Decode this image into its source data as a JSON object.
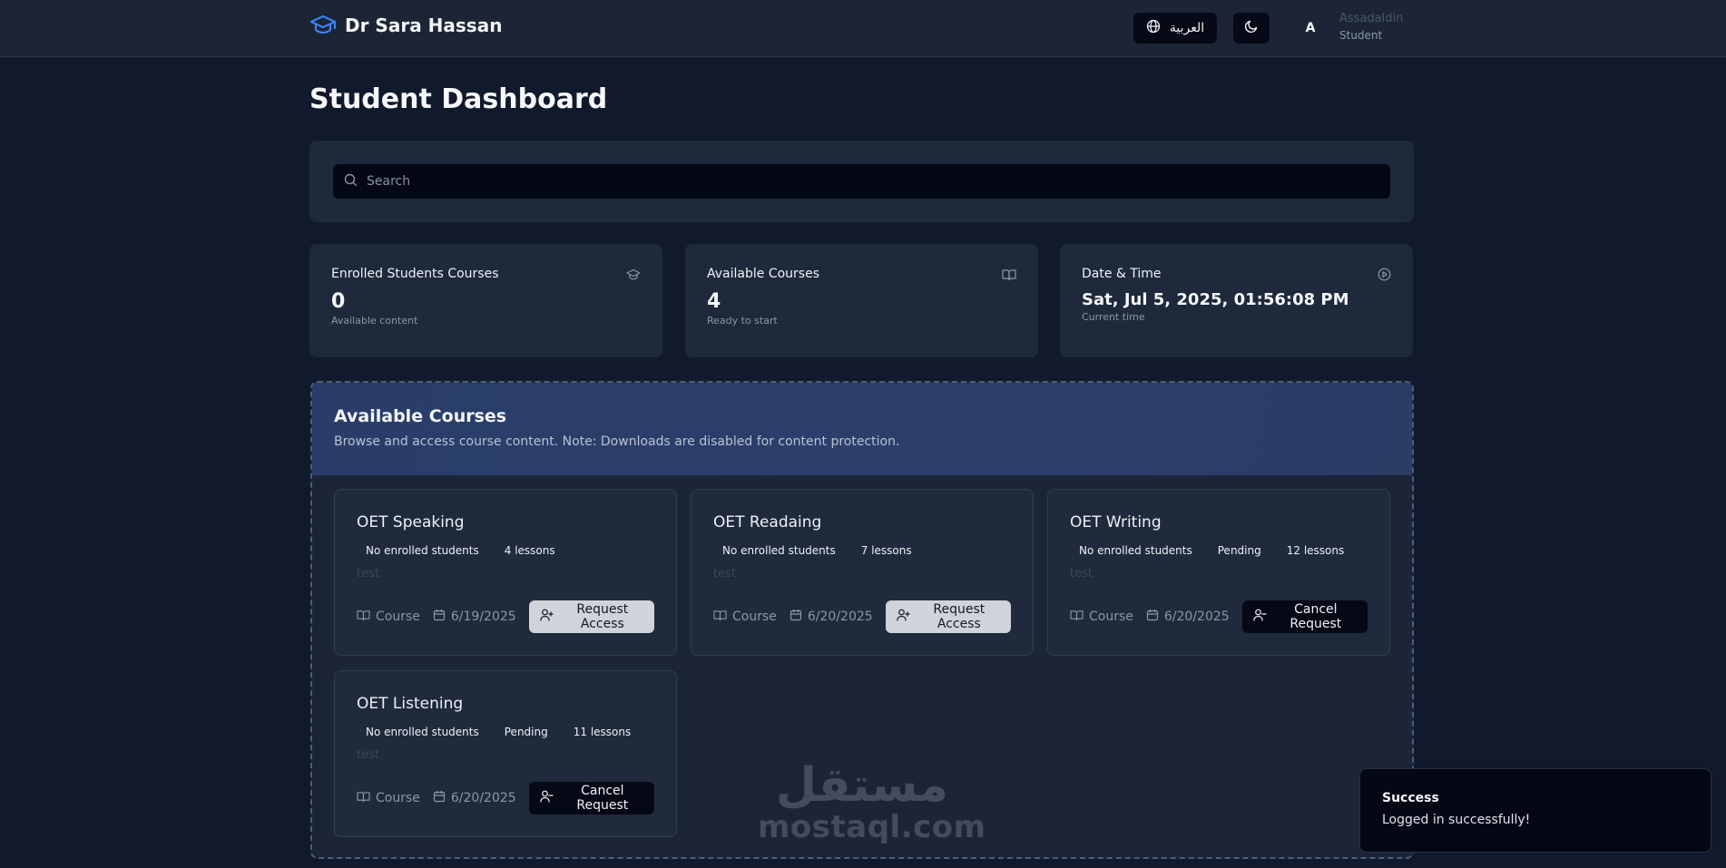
{
  "header": {
    "brand_name": "Dr Sara Hassan",
    "language_label": "العربية",
    "avatar_initial": "A",
    "user_name": "Assadaldin",
    "user_role": "Student"
  },
  "page": {
    "title": "Student Dashboard"
  },
  "search": {
    "placeholder": "Search",
    "value": ""
  },
  "stats": [
    {
      "title": "Enrolled Students Courses",
      "value": "0",
      "sub": "Available content",
      "icon": "graduation-cap-icon"
    },
    {
      "title": "Available Courses",
      "value": "4",
      "sub": "Ready to start",
      "icon": "book-open-icon"
    },
    {
      "title": "Date & Time",
      "value": "Sat, Jul 5, 2025, 01:56:08 PM",
      "sub": "Current time",
      "icon": "play-circle-icon"
    }
  ],
  "courses_section": {
    "title": "Available Courses",
    "description": "Browse and access course content. Note: Downloads are disabled for content protection."
  },
  "courses": [
    {
      "name": "OET Speaking",
      "badges": [
        "No enrolled students",
        "4 lessons"
      ],
      "description": "test",
      "type": "Course",
      "date": "6/19/2025",
      "action": "Request Access"
    },
    {
      "name": "OET Readaing",
      "badges": [
        "No enrolled students",
        "7 lessons"
      ],
      "description": "test",
      "type": "Course",
      "date": "6/20/2025",
      "action": "Request Access"
    },
    {
      "name": "OET Writing",
      "badges": [
        "No enrolled students",
        "Pending",
        "12 lessons"
      ],
      "description": "test",
      "type": "Course",
      "date": "6/20/2025",
      "action": "Cancel Request"
    },
    {
      "name": "OET Listening",
      "badges": [
        "No enrolled students",
        "Pending",
        "11 lessons"
      ],
      "description": "test",
      "type": "Course",
      "date": "6/20/2025",
      "action": "Cancel Request"
    }
  ],
  "watermark": {
    "arabic": "مستقل",
    "latin": "mostaql.com"
  },
  "toast": {
    "title": "Success",
    "message": "Logged in successfully!"
  },
  "colors": {
    "background": "#111a2c",
    "card": "#1e293b",
    "accent": "#3b82f6",
    "panel_header": "#2a3d6a"
  }
}
